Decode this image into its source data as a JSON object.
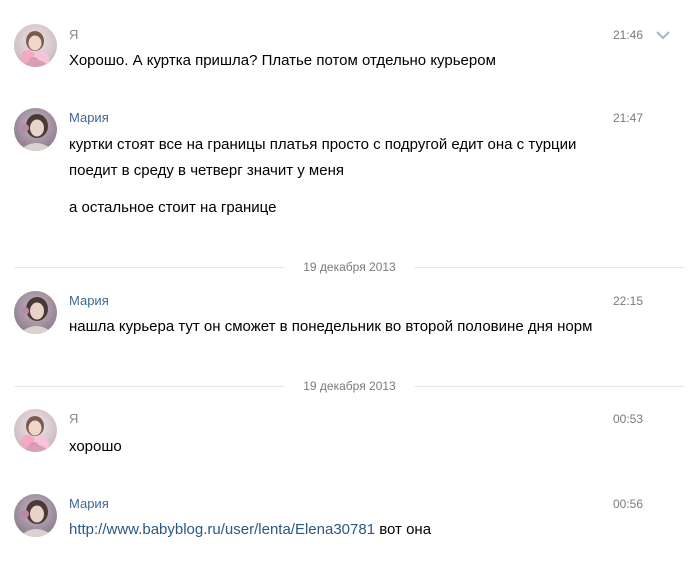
{
  "messages": [
    {
      "author": "Я",
      "time": "21:46",
      "avatar": "girl-with-flowers-avatar",
      "lines": [
        "Хорошо. А куртка пришла? Платье потом отдельно курьером"
      ]
    },
    {
      "author": "Мария",
      "time": "21:47",
      "avatar": "woman-portrait-avatar",
      "lines": [
        "куртки стоят все на границы платья просто с подругой едит она с турции",
        "поедит в среду в четверг значит у меня",
        "а остальное стоит на границе"
      ]
    },
    {
      "date_separator": "19 декабря 2013"
    },
    {
      "author": "Мария",
      "time": "22:15",
      "avatar": "woman-portrait-avatar",
      "lines": [
        "нашла курьера тут он сможет в понедельник во второй половине дня норм"
      ]
    },
    {
      "date_separator": "19 декабря 2013"
    },
    {
      "author": "Я",
      "time": "00:53",
      "avatar": "girl-with-flowers-avatar",
      "lines": [
        "хорошо"
      ]
    },
    {
      "author": "Мария",
      "time": "00:56",
      "avatar": "woman-portrait-avatar",
      "link": "http://www.babyblog.ru/user/lenta/Elena30781",
      "after_link": " вот она"
    }
  ],
  "colors": {
    "author_me": "#8a8a8a",
    "author_other": "#3e6895",
    "link": "#2a5885",
    "meta": "#7a7a7a",
    "separator_line": "#e7e8ec"
  },
  "icons": [
    "chevron-down-icon"
  ]
}
